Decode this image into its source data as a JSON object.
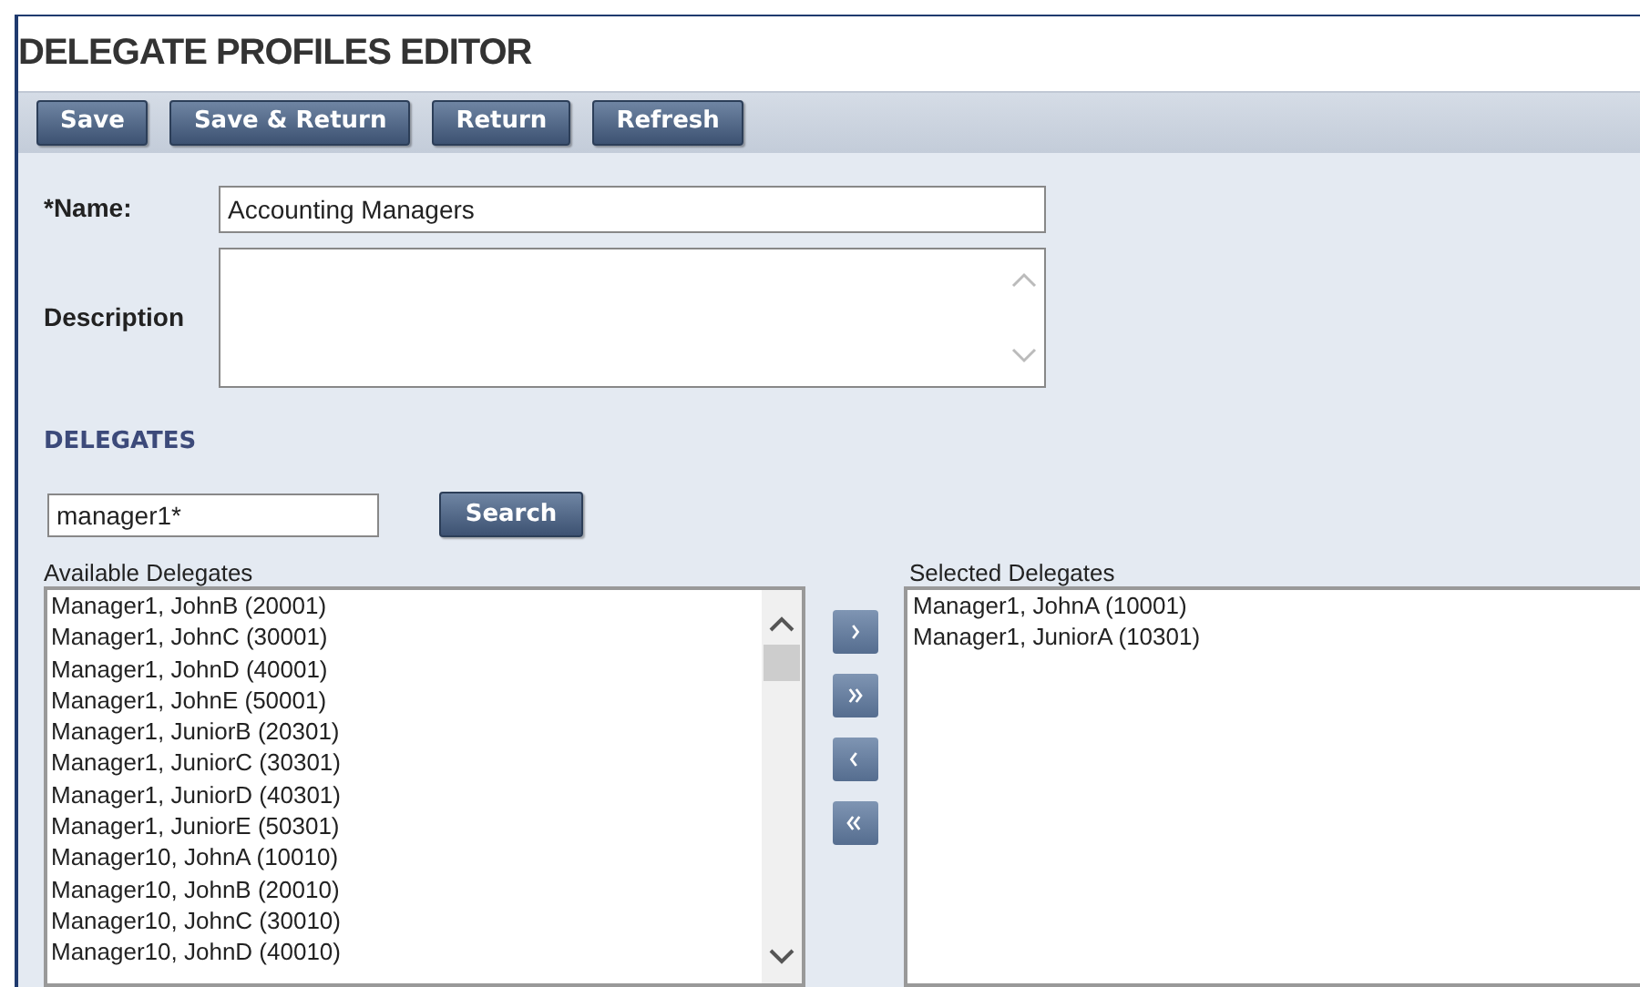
{
  "title": "DELEGATE PROFILES EDITOR",
  "toolbar": [
    "Save",
    "Save & Return",
    "Return",
    "Refresh"
  ],
  "name_field": {
    "label": "*Name:",
    "value": "Accounting Managers"
  },
  "description_field": {
    "label": "Description"
  },
  "section_title": "DELEGATES",
  "search": {
    "value": "manager1*",
    "button": "Search"
  },
  "available": {
    "label": "Available Delegates",
    "items": [
      "Manager1, JohnB (20001)",
      "Manager1, JohnC (30001)",
      "Manager1, JohnD (40001)",
      "Manager1, JohnE (50001)",
      "Manager1, JuniorB (20301)",
      "Manager1, JuniorC (30301)",
      "Manager1, JuniorD (40301)",
      "Manager1, JuniorE (50301)",
      "Manager10, JohnA (10010)",
      "Manager10, JohnB (20010)",
      "Manager10, JohnC (30010)",
      "Manager10, JohnD (40010)"
    ]
  },
  "transfer_buttons": [
    {
      "kind": "add"
    },
    {
      "kind": "add_all"
    },
    {
      "kind": "remove"
    },
    {
      "kind": "remove_all"
    }
  ],
  "selected": {
    "label": "Selected Delegates",
    "items": [
      "Manager1, JohnA (10001)",
      "Manager1, JuniorA (10301)"
    ]
  }
}
